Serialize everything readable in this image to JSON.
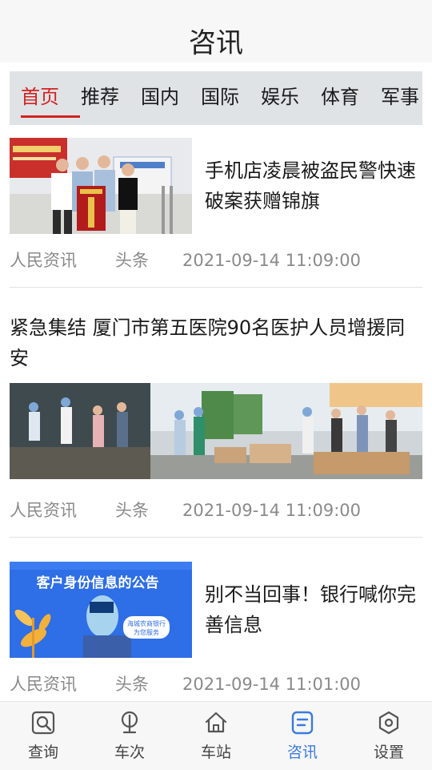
{
  "header": {
    "title": "咨讯"
  },
  "tabs": [
    {
      "label": "首页",
      "active": true
    },
    {
      "label": "推荐"
    },
    {
      "label": "国内"
    },
    {
      "label": "国际"
    },
    {
      "label": "娱乐"
    },
    {
      "label": "体育"
    },
    {
      "label": "军事"
    }
  ],
  "articles": [
    {
      "title": "手机店凌晨被盗民警快速破案获赠锦旗",
      "source": "人民资讯",
      "tag": "头条",
      "time": "2021-09-14 11:09:00",
      "image": "police-award-photo"
    },
    {
      "title": "紧急集结 厦门市第五医院90名医护人员增援同安",
      "source": "人民资讯",
      "tag": "头条",
      "time": "2021-09-14 11:09:00",
      "image": "medical-staff-photo"
    },
    {
      "title": "别不当回事！银行喊你完善信息",
      "source": "人民资讯",
      "tag": "头条",
      "time": "2021-09-14 11:01:00",
      "image": "bank-notice-photo",
      "image_text": "客户身份信息的公告",
      "image_subtext": [
        "海城农商银行",
        "为您服务"
      ]
    }
  ],
  "bottom_nav": [
    {
      "label": "查询",
      "icon": "search-icon"
    },
    {
      "label": "车次",
      "icon": "train-icon"
    },
    {
      "label": "车站",
      "icon": "home-icon"
    },
    {
      "label": "咨讯",
      "icon": "news-icon",
      "active": true
    },
    {
      "label": "设置",
      "icon": "settings-icon"
    }
  ],
  "colors": {
    "accent": "#d22222",
    "nav_active": "#3a7be0",
    "meta": "#8a8a8a"
  }
}
